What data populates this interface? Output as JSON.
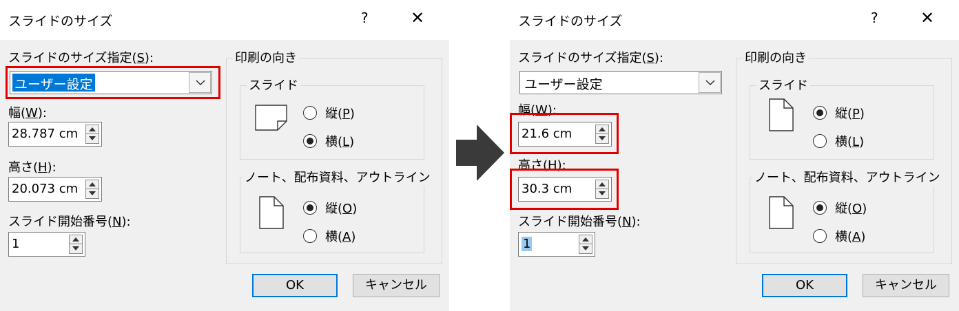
{
  "left": {
    "title": "スライドのサイズ",
    "help": "?",
    "close": "✕",
    "size_label_pre": "スライドのサイズ指定(",
    "size_label_key": "S",
    "size_label_post": "):",
    "size_value": "ユーザー設定",
    "width_label_pre": "幅(",
    "width_label_key": "W",
    "width_label_post": "):",
    "width_value": "28.787 cm",
    "height_label_pre": "高さ(",
    "height_label_key": "H",
    "height_label_post": "):",
    "height_value": "20.073 cm",
    "start_label_pre": "スライド開始番号(",
    "start_label_key": "N",
    "start_label_post": "):",
    "start_value": "1",
    "orientation_title": "印刷の向き",
    "slide_group": "スライド",
    "portrait_pre": "縦(",
    "portrait_key_slide": "P",
    "landscape_pre": "横(",
    "landscape_key_slide": "L",
    "close_paren": ")",
    "notes_group": "ノート、配布資料、アウトライン",
    "portrait_key_notes": "O",
    "landscape_key_notes": "A",
    "ok": "OK",
    "cancel": "キャンセル"
  },
  "right": {
    "width_value": "21.6 cm",
    "height_value": "30.3 cm"
  }
}
